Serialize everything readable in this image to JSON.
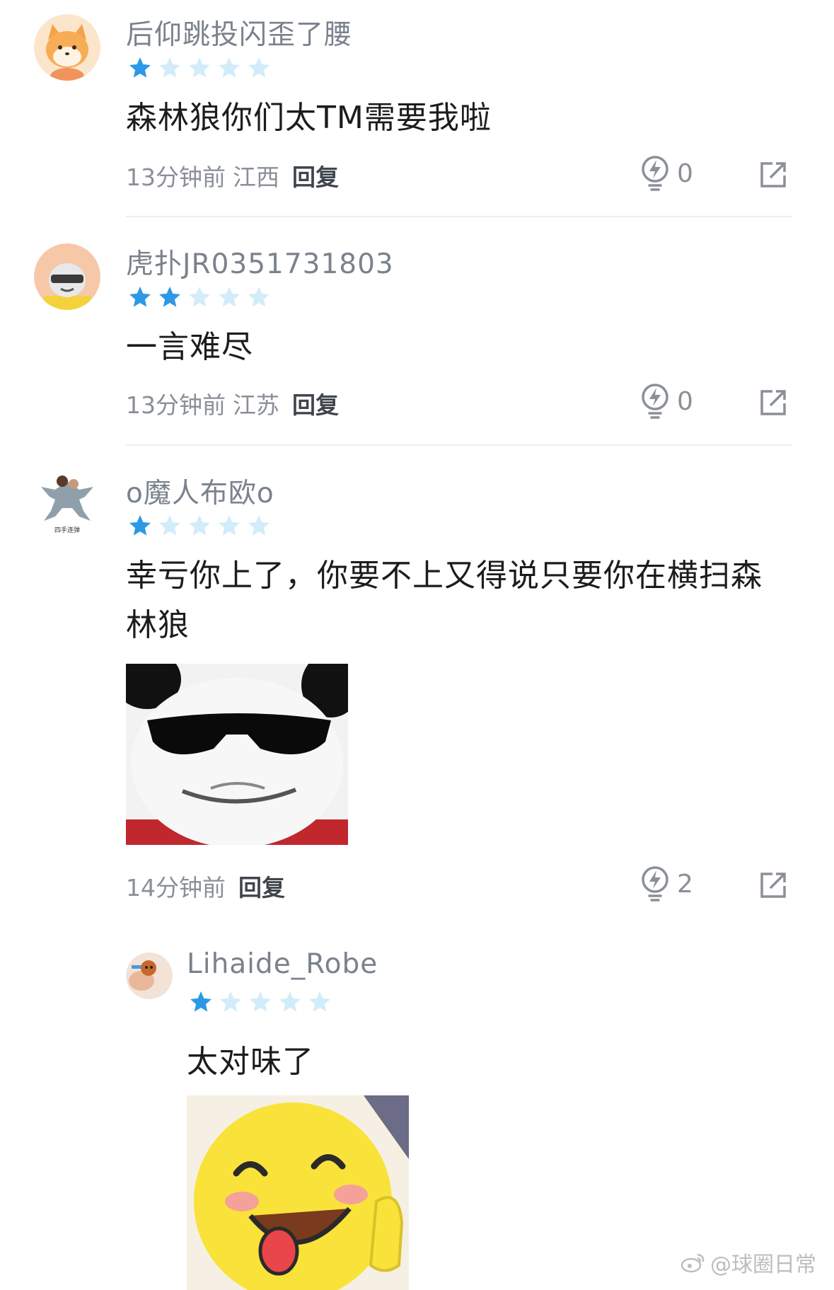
{
  "comments": [
    {
      "username": "后仰跳投闪歪了腰",
      "rating": 1,
      "content": "森林狼你们太TM需要我啦",
      "time": "13分钟前",
      "location": "江西",
      "reply": "回复",
      "likes": "0"
    },
    {
      "username": "虎扑JR0351731803",
      "rating": 2,
      "content": "一言难尽",
      "time": "13分钟前",
      "location": "江苏",
      "reply": "回复",
      "likes": "0"
    },
    {
      "username": "o魔人布欧o",
      "rating": 1,
      "content": "幸亏你上了，你要不上又得说只要你在横扫森林狼",
      "avatar_caption": "四手连弹",
      "time": "14分钟前",
      "location": "",
      "reply": "回复",
      "likes": "2"
    }
  ],
  "nested_reply": {
    "username": "Lihaide_Robe",
    "rating": 1,
    "content": "太对味了"
  },
  "watermark": "@球圈日常",
  "colors": {
    "star_active": "#2c98e6",
    "star_inactive": "#d3ecfa",
    "username": "#7a828d",
    "text": "#1c1c1e",
    "meta": "#8a8f98"
  },
  "icons": [
    "star-icon",
    "lightning-like-icon",
    "share-icon",
    "weibo-logo-icon"
  ]
}
